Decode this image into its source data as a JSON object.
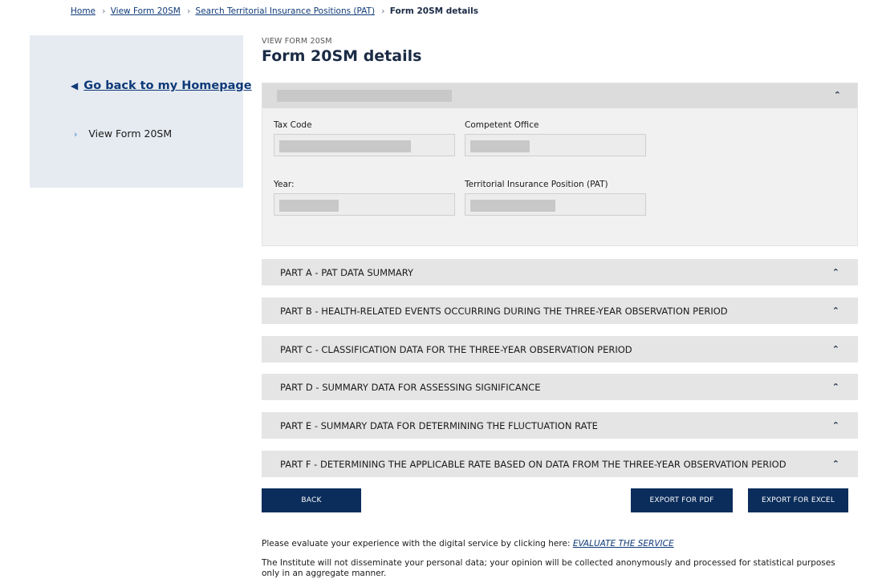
{
  "breadcrumb": {
    "items": [
      "Home",
      "View Form 20SM",
      "Search Territorial Insurance Positions (PAT)"
    ],
    "current": "Form 20SM details"
  },
  "sidebar": {
    "back_link": "Go back to my Homepage",
    "items": [
      {
        "label": "View Form 20SM"
      }
    ]
  },
  "header": {
    "kicker": "VIEW FORM 20SM",
    "title": "Form 20SM details"
  },
  "details_card": {
    "fields": {
      "tax_code": "Tax Code",
      "competent_office": "Competent Office",
      "year": "Year:",
      "pat": "Territorial Insurance Position (PAT)"
    }
  },
  "sections": [
    "PART A - PAT DATA SUMMARY",
    "PART B - HEALTH-RELATED EVENTS OCCURRING DURING THE THREE-YEAR OBSERVATION PERIOD",
    "PART C - CLASSIFICATION DATA FOR THE THREE-YEAR OBSERVATION PERIOD",
    "PART D - SUMMARY DATA FOR ASSESSING SIGNIFICANCE",
    "PART E - SUMMARY DATA FOR DETERMINING THE FLUCTUATION RATE",
    "PART F - DETERMINING THE APPLICABLE RATE BASED ON DATA FROM THE THREE-YEAR OBSERVATION PERIOD"
  ],
  "buttons": {
    "back": "BACK",
    "export_pdf": "EXPORT FOR PDF",
    "export_excel": "EXPORT FOR EXCEL"
  },
  "footer": {
    "evaluate_prefix": "Please evaluate your experience with the digital service by clicking here: ",
    "evaluate_link": "EVALUATE THE SERVICE",
    "privacy": "The Institute will not disseminate your personal data; your opinion will be collected anonymously and processed for statistical purposes only in an aggregate manner."
  },
  "icons": {
    "breadcrumb_separator": "chevron-right-icon",
    "back": "caret-left-icon",
    "accordion": "chevron-up-icon"
  },
  "colors": {
    "primary": "#0b2d5b",
    "link": "#0f3a78",
    "sidebar_bg": "#e6ebf1",
    "accordion_bg": "#e5e5e5"
  }
}
